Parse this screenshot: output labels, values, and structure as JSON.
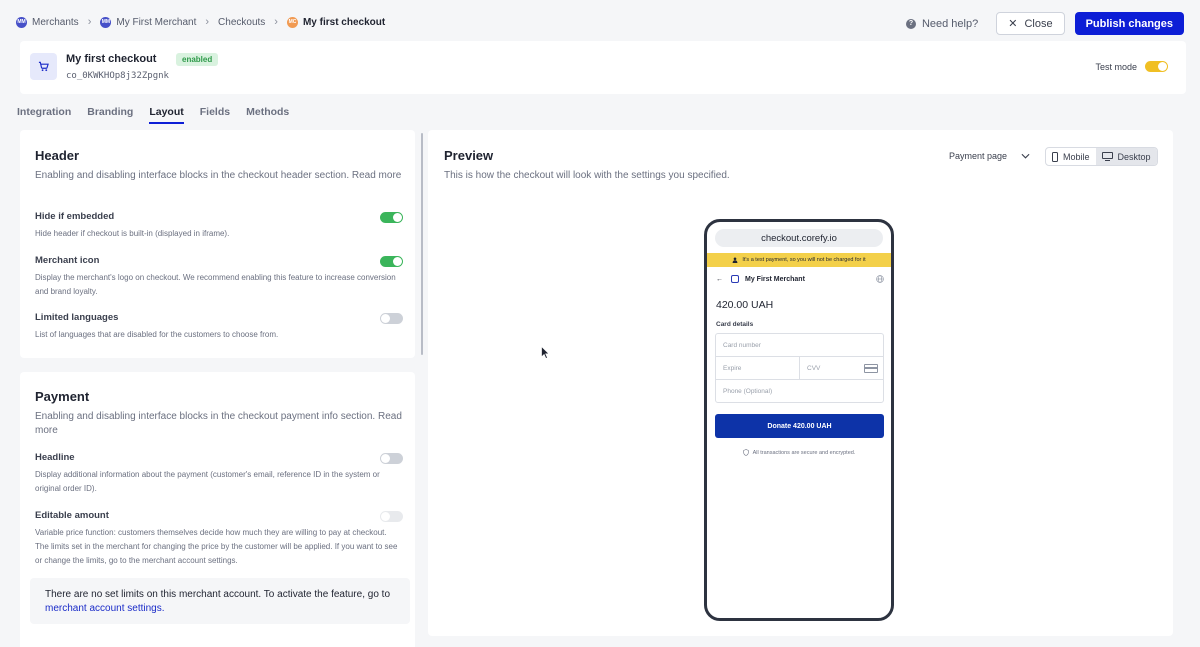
{
  "breadcrumb": [
    {
      "avatar": "MM",
      "label": "Merchants"
    },
    {
      "avatar": "MM",
      "label": "My First Merchant"
    },
    {
      "avatar": "",
      "label": "Checkouts"
    },
    {
      "avatar": "MC",
      "label": "My first checkout"
    }
  ],
  "actions": {
    "help": "Need help?",
    "close": "Close",
    "publish": "Publish changes"
  },
  "checkout": {
    "name": "My first checkout",
    "status": "enabled",
    "id": "co_0KWKHOp8j32Zpgnk",
    "test_mode_label": "Test mode",
    "test_mode_on": true
  },
  "tabs": [
    {
      "label": "Integration",
      "active": false
    },
    {
      "label": "Branding",
      "active": false
    },
    {
      "label": "Layout",
      "active": true
    },
    {
      "label": "Fields",
      "active": false
    },
    {
      "label": "Methods",
      "active": false
    }
  ],
  "header_section": {
    "title": "Header",
    "description": "Enabling and disabling interface blocks in the checkout header section. Read more",
    "settings": [
      {
        "title": "Hide if embedded",
        "description": "Hide header if checkout is built-in (displayed in iframe).",
        "on": true
      },
      {
        "title": "Merchant icon",
        "description": "Display the merchant's logo on checkout. We recommend enabling this feature to increase conversion and brand loyalty.",
        "on": true
      },
      {
        "title": "Limited languages",
        "description": "List of languages that are disabled for the customers to choose from.",
        "on": false
      }
    ]
  },
  "payment_section": {
    "title": "Payment",
    "description": "Enabling and disabling interface blocks in the checkout payment info section. Read more",
    "settings": [
      {
        "title": "Headline",
        "description": "Display additional information about the payment (customer's email, reference ID in the system or original order ID).",
        "on": false
      },
      {
        "title": "Editable amount",
        "description": "Variable price function: customers themselves decide how much they are willing to pay at checkout. The limits set in the merchant for changing the price by the customer will be applied. If you want to see or change the limits, go to the merchant account settings.",
        "on": false
      }
    ],
    "notice_text": "There are no set limits on this merchant account. To activate the feature, go to",
    "notice_link": "merchant account settings."
  },
  "preview": {
    "title": "Preview",
    "description": "This is how the checkout will look with the settings you specified.",
    "page_select": "Payment page",
    "view_mobile": "Mobile",
    "view_desktop": "Desktop",
    "active_view": "Desktop"
  },
  "phone": {
    "url": "checkout.corefy.io",
    "test_banner": "It's a test payment, so you will not be charged for it",
    "merchant": "My First Merchant",
    "amount": "420.00 UAH",
    "card_details_label": "Card details",
    "card_number_placeholder": "Card number",
    "expire_placeholder": "Expire",
    "cvv_placeholder": "CVV",
    "phone_placeholder": "Phone (Optional)",
    "donate_button": "Donate 420.00 UAH",
    "secure_note": "All transactions are secure and encrypted."
  },
  "colors": {
    "accent": "#0d1ed6",
    "toggle_on": "#3bb55b",
    "test_mode": "#f0bf24",
    "banner": "#f3d04a",
    "donate": "#0d33a8"
  }
}
